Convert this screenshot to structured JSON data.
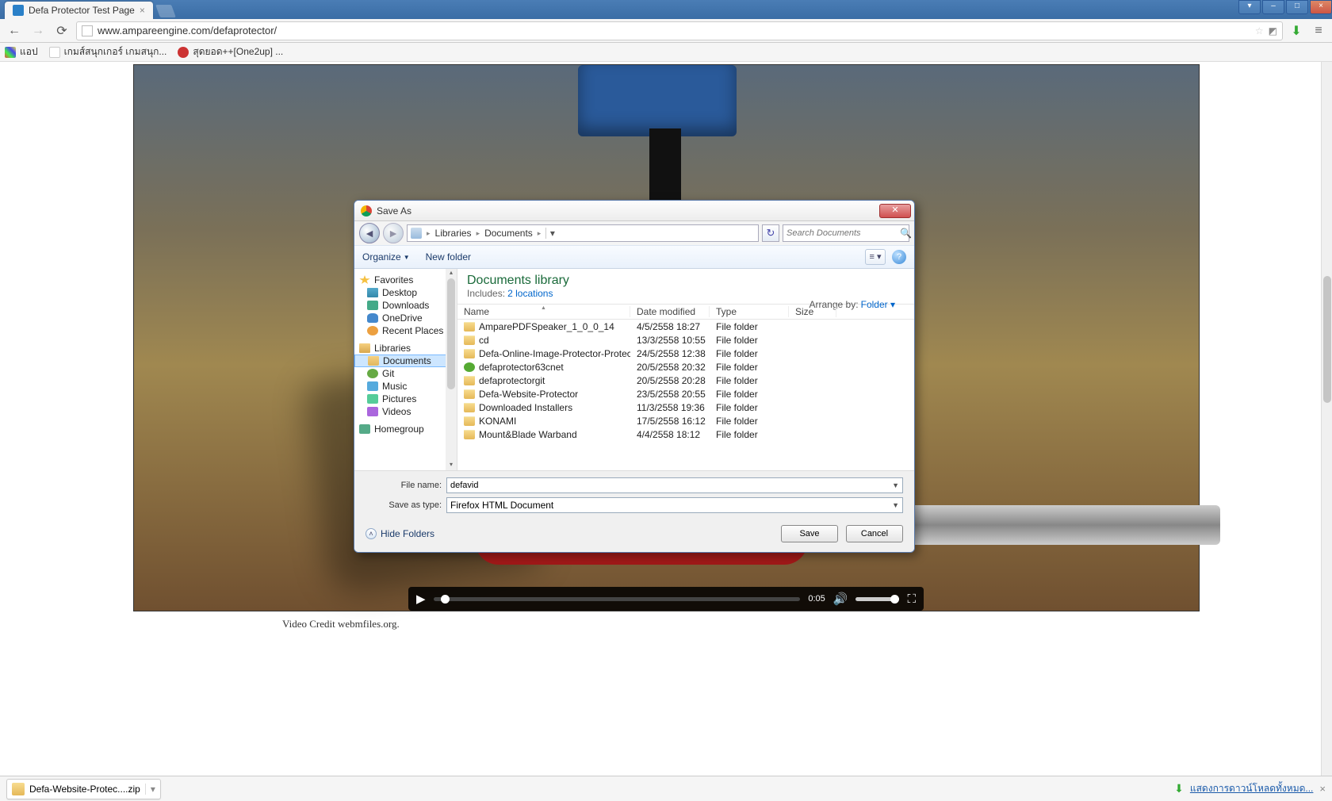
{
  "browser": {
    "tab_title": "Defa Protector Test Page",
    "url": "www.ampareengine.com/defaprotector/",
    "bookmarks": [
      {
        "label": "แอป"
      },
      {
        "label": "เกมส์สนุกเกอร์ เกมสนุก..."
      },
      {
        "label": "สุดยอด++[One2up] ..."
      }
    ],
    "download_item": "Defa-Website-Protec....zip",
    "download_shelf_link": "แสดงการดาวน์โหลดทั้งหมด..."
  },
  "page": {
    "video_time": "0:05",
    "credit": "Video Credit webmfiles.org."
  },
  "dialog": {
    "title": "Save As",
    "breadcrumb": [
      "Libraries",
      "Documents"
    ],
    "search_placeholder": "Search Documents",
    "toolbar": {
      "organize": "Organize",
      "new_folder": "New folder"
    },
    "library": {
      "heading": "Documents library",
      "includes_label": "Includes:",
      "includes_link": "2 locations",
      "arrange_label": "Arrange by:",
      "arrange_value": "Folder"
    },
    "tree": {
      "favorites": "Favorites",
      "favorites_items": [
        "Desktop",
        "Downloads",
        "OneDrive",
        "Recent Places"
      ],
      "libraries": "Libraries",
      "libraries_items": [
        "Documents",
        "Git",
        "Music",
        "Pictures",
        "Videos"
      ],
      "homegroup": "Homegroup"
    },
    "columns": {
      "name": "Name",
      "date": "Date modified",
      "type": "Type",
      "size": "Size"
    },
    "files": [
      {
        "icon": "folder",
        "name": "AmparePDFSpeaker_1_0_0_14",
        "date": "4/5/2558 18:27",
        "type": "File folder",
        "size": ""
      },
      {
        "icon": "folder",
        "name": "cd",
        "date": "13/3/2558 10:55",
        "type": "File folder",
        "size": ""
      },
      {
        "icon": "folder",
        "name": "Defa-Online-Image-Protector-Protect-I...",
        "date": "24/5/2558 12:38",
        "type": "File folder",
        "size": ""
      },
      {
        "icon": "gitf",
        "name": "defaprotector63cnet",
        "date": "20/5/2558 20:32",
        "type": "File folder",
        "size": ""
      },
      {
        "icon": "folder",
        "name": "defaprotectorgit",
        "date": "20/5/2558 20:28",
        "type": "File folder",
        "size": ""
      },
      {
        "icon": "folder",
        "name": "Defa-Website-Protector",
        "date": "23/5/2558 20:55",
        "type": "File folder",
        "size": ""
      },
      {
        "icon": "folder",
        "name": "Downloaded Installers",
        "date": "11/3/2558 19:36",
        "type": "File folder",
        "size": ""
      },
      {
        "icon": "folder",
        "name": "KONAMI",
        "date": "17/5/2558 16:12",
        "type": "File folder",
        "size": ""
      },
      {
        "icon": "folder",
        "name": "Mount&Blade Warband",
        "date": "4/4/2558 18:12",
        "type": "File folder",
        "size": ""
      }
    ],
    "fields": {
      "file_name_label": "File name:",
      "file_name_value": "defavid",
      "save_type_label": "Save as type:",
      "save_type_value": "Firefox HTML Document"
    },
    "footer": {
      "hide_folders": "Hide Folders",
      "save": "Save",
      "cancel": "Cancel"
    }
  }
}
